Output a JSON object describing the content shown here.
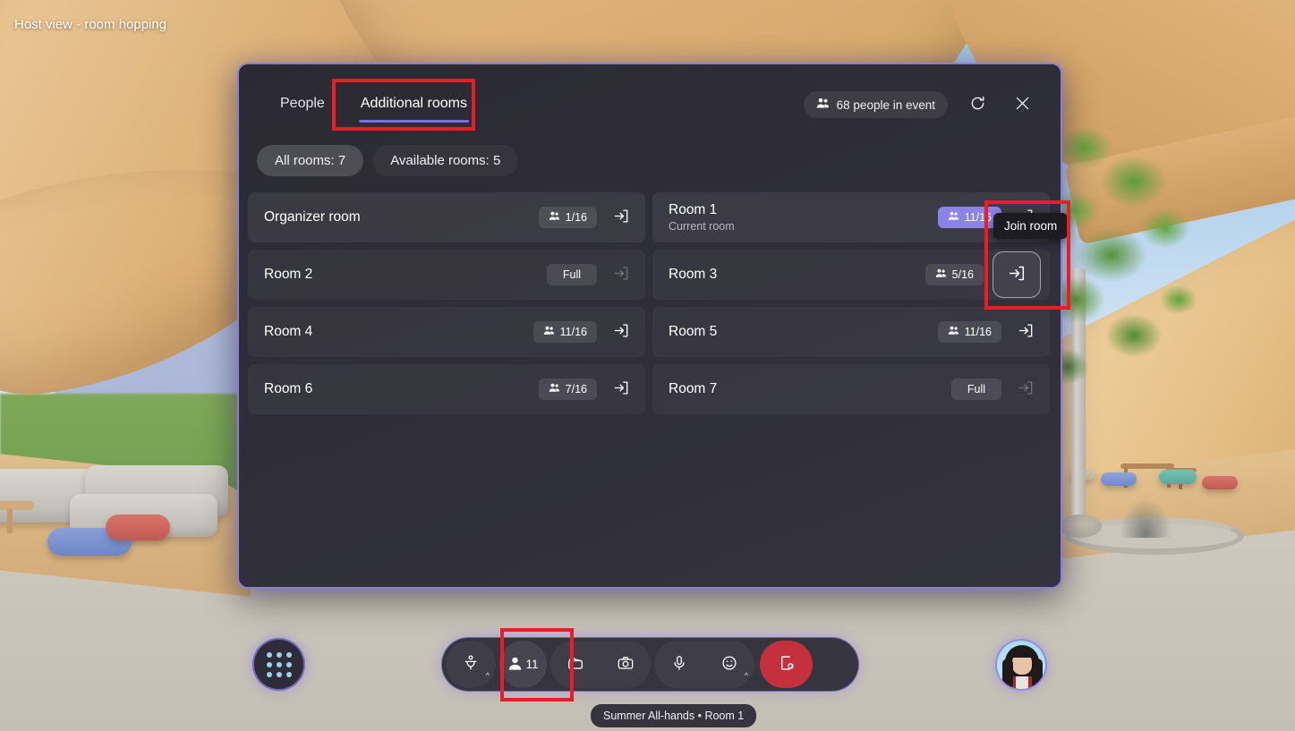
{
  "page": {
    "title": "Host view - room hopping"
  },
  "panel": {
    "tabs": [
      {
        "label": "People",
        "active": false
      },
      {
        "label": "Additional rooms",
        "active": true
      }
    ],
    "people_in_event": "68 people in event",
    "people_icon": "people-group-icon",
    "refresh_icon": "refresh-icon",
    "close_icon": "close-icon",
    "filters": [
      {
        "label": "All rooms: 7",
        "selected": true
      },
      {
        "label": "Available rooms: 5",
        "selected": false
      }
    ],
    "rooms": [
      {
        "name": "Organizer room",
        "subtitle": "",
        "count": "1/16",
        "state": "open",
        "current": false,
        "join_enabled": true,
        "focused": false
      },
      {
        "name": "Room 1",
        "subtitle": "Current room",
        "count": "11/16",
        "state": "current",
        "current": true,
        "join_enabled": true,
        "focused": false
      },
      {
        "name": "Room 2",
        "subtitle": "",
        "count": "Full",
        "state": "full",
        "current": false,
        "join_enabled": false,
        "focused": false
      },
      {
        "name": "Room 3",
        "subtitle": "",
        "count": "5/16",
        "state": "open",
        "current": false,
        "join_enabled": true,
        "focused": true
      },
      {
        "name": "Room 4",
        "subtitle": "",
        "count": "11/16",
        "state": "open",
        "current": false,
        "join_enabled": true,
        "focused": false
      },
      {
        "name": "Room 5",
        "subtitle": "",
        "count": "11/16",
        "state": "open",
        "current": false,
        "join_enabled": true,
        "focused": false
      },
      {
        "name": "Room 6",
        "subtitle": "",
        "count": "7/16",
        "state": "open",
        "current": false,
        "join_enabled": true,
        "focused": false
      },
      {
        "name": "Room 7",
        "subtitle": "",
        "count": "Full",
        "state": "full",
        "current": false,
        "join_enabled": false,
        "focused": false
      }
    ],
    "tooltip": "Join room",
    "join_icon": "enter-arrow-icon"
  },
  "toolbar": {
    "apps_grid_icon": "apps-grid-icon",
    "raise_hand": {
      "icon": "raise-hand-icon",
      "chevron": "chevron-up-icon"
    },
    "people": {
      "icon": "person-icon",
      "count": "11"
    },
    "clapper": {
      "icon": "clapperboard-icon"
    },
    "camera": {
      "icon": "camera-icon"
    },
    "mic": {
      "icon": "microphone-icon"
    },
    "reactions": {
      "icon": "smiley-icon",
      "chevron": "chevron-up-icon"
    },
    "leave": {
      "icon": "leave-door-icon"
    },
    "room_label": "Summer All-hands • Room 1",
    "avatar": "user-avatar"
  },
  "colors": {
    "accent_purple": "#8a84e8",
    "panel_border": "#8a7fd6",
    "tab_underline": "#7a6ee0",
    "leave_red": "#c4303c",
    "annotation_red": "#ec1c24"
  }
}
